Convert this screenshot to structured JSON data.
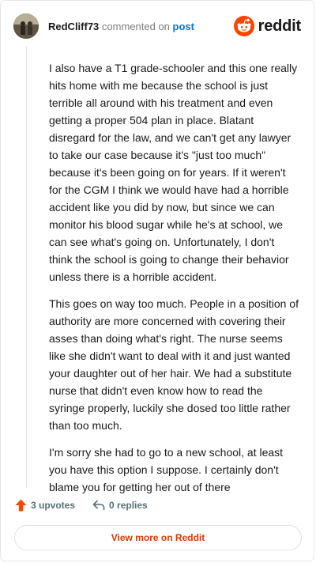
{
  "header": {
    "username": "RedCliff73",
    "commented_text": "commented on",
    "post_link": "post",
    "brand_name": "reddit",
    "brand_color": "#ff4500",
    "avatar_icon": "user-avatar-photo"
  },
  "comment": {
    "paragraphs": [
      "I also have a T1 grade-schooler and this one really hits home with me because the school is just terrible all around with his treatment and even getting a proper 504 plan in place. Blatant disregard for the law, and we can't get any lawyer to take our case because it's \"just too much\" because it's been going on for years. If it weren't for the CGM I think we would have had a horrible accident like you did by now, but since we can monitor his blood sugar while he's at school, we can see what's going on. Unfortunately, I don't think the school is going to change their behavior unless there is a horrible accident.",
      "This goes on way too much. People in a position of authority are more concerned with covering their asses than doing what's right. The nurse seems like she didn't want to deal with it and just wanted your daughter out of her hair. We had a substitute nurse that didn't even know how to read the syringe properly, luckily she dosed too little rather than too much.",
      "I'm sorry she had to go to a new school, at least you have this option I suppose. I certainly don't blame you for getting her out of there"
    ]
  },
  "actions": {
    "upvotes": "3 upvotes",
    "replies": "0 replies",
    "upvote_color": "#ff4500",
    "upvote_icon": "upvote-arrow-icon",
    "reply_icon": "reply-arrow-icon"
  },
  "footer": {
    "view_more": "View more on Reddit",
    "view_more_color": "#d93a00"
  }
}
